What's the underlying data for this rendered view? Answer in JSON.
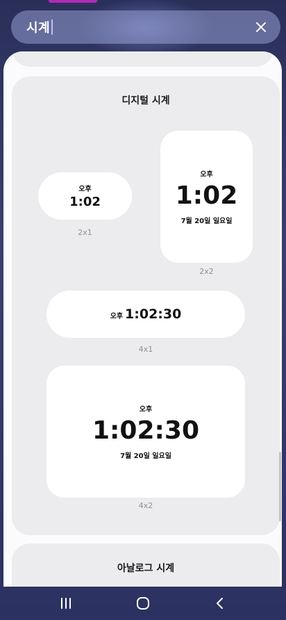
{
  "search": {
    "query": "시계"
  },
  "sections": {
    "digital": {
      "title": "디지털 시계",
      "widgets": {
        "w2x1": {
          "ampm": "오후",
          "time": "1:02",
          "size": "2x1"
        },
        "w2x2": {
          "ampm": "오후",
          "time": "1:02",
          "date": "7월 20일 일요일",
          "size": "2x2"
        },
        "w4x1": {
          "ampm": "오후",
          "time": "1:02:30",
          "size": "4x1"
        },
        "w4x2": {
          "ampm": "오후",
          "time": "1:02:30",
          "date": "7월 20일 일요일",
          "size": "4x2"
        }
      }
    },
    "analog": {
      "title": "아날로그 시계"
    }
  },
  "icons": {
    "close": "close-icon",
    "recents": "recents-icon",
    "home": "home-icon",
    "back": "back-icon"
  },
  "colors": {
    "accent": "#b02ab8",
    "panel": "#fbfbfd",
    "card": "#ececee"
  }
}
